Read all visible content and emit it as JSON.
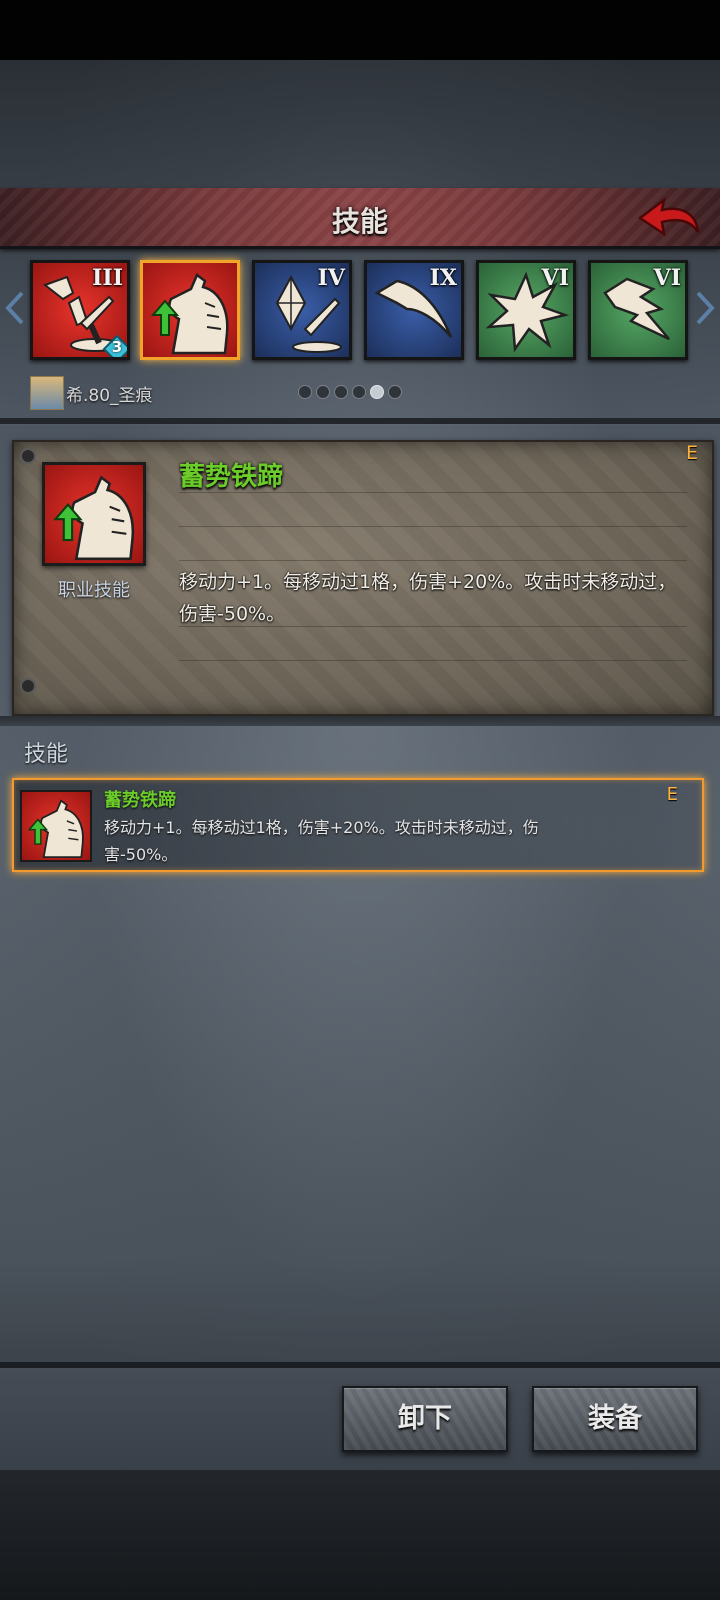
{
  "title": "技能",
  "skills_row": [
    {
      "rank": "III",
      "level_badge": "3",
      "color": "#c8201e",
      "icon": "broken-sword-icon"
    },
    {
      "rank": "",
      "color": "#c8201e",
      "icon": "horse-arrow-up-icon"
    },
    {
      "rank": "IV",
      "color": "#27457e",
      "icon": "crystal-sword-icon"
    },
    {
      "rank": "IX",
      "color": "#27457e",
      "icon": "feather-icon"
    },
    {
      "rank": "VI",
      "color": "#3f8a4e",
      "icon": "burst-icon"
    },
    {
      "rank": "VI",
      "color": "#3f8a4e",
      "icon": "claw-icon"
    }
  ],
  "character": {
    "name": "希.80_圣痕"
  },
  "pagination": {
    "total": 6,
    "active_index": 4
  },
  "detail": {
    "name": "蓄势铁蹄",
    "type": "职业技能",
    "rank": "E",
    "description": "移动力+1。每移动过1格，伤害+20%。攻击时未移动过，伤害-50%。"
  },
  "section_label": "技能",
  "list": [
    {
      "name": "蓄势铁蹄",
      "rank": "E",
      "description": "移动力+1。每移动过1格，伤害+20%。攻击时未移动过，伤害-50%。"
    }
  ],
  "buttons": {
    "unequip": "卸下",
    "equip": "装备"
  },
  "colors": {
    "accent": "#f39a2e",
    "skill_name": "#6bcc2a",
    "rank": "#ffb23c"
  }
}
